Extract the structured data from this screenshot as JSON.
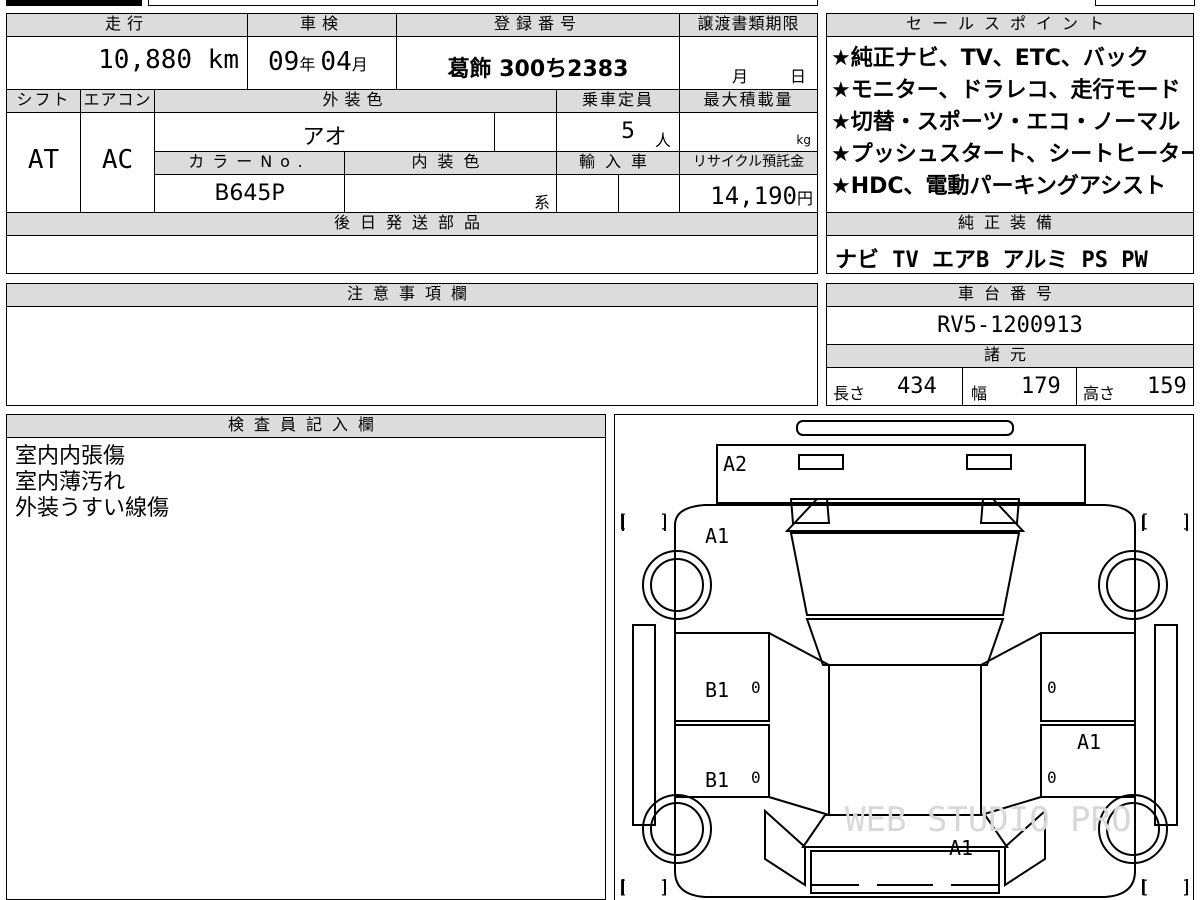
{
  "headers": {
    "mileage": "走行",
    "inspection": "車検",
    "registration": "登録番号",
    "transfer_deadline": "譲渡書類期限",
    "sales_point": "セールスポイント",
    "shift": "シフト",
    "aircon": "エアコン",
    "exterior_color": "外装色",
    "capacity": "乗車定員",
    "max_load": "最大積載量",
    "color_no": "カラーNo.",
    "interior_color": "内装色",
    "import": "輸入車",
    "recycle": "リサイクル預託金",
    "later_parts": "後日発送部品",
    "genuine_equipment": "純正装備",
    "notes": "注意事項欄",
    "chassis": "車台番号",
    "specs": "諸元",
    "inspector": "検査員記入欄"
  },
  "values": {
    "mileage": "10,880 km",
    "inspection_year": "09",
    "year_unit": "年",
    "inspection_month": "04",
    "month_unit": "月",
    "registration": "葛飾 300ち2383",
    "transfer_month": "月",
    "transfer_day": "日",
    "shift": "AT",
    "aircon": "AC",
    "exterior_color": "アオ",
    "capacity": "5",
    "capacity_unit": "人",
    "max_load_unit": "kg",
    "color_no": "B645P",
    "interior_suffix": "系",
    "recycle": "14,190",
    "recycle_unit": "円",
    "genuine_equipment": "ナビ TV エアB アルミ PS PW",
    "chassis": "RV5-1200913",
    "length_label": "長さ",
    "length": "434",
    "width_label": "幅",
    "width": "179",
    "height_label": "高さ",
    "height": "159"
  },
  "sales_points": [
    "★純正ナビ、TV、ETC、バック",
    "★モニター、ドラレコ、走行モード",
    "★切替・スポーツ・エコ・ノーマル",
    "★プッシュスタート、シートヒーター",
    "★HDC、電動パーキングアシスト"
  ],
  "inspector_remarks": [
    "室内内張傷",
    "室内薄汚れ",
    "外装うすい線傷"
  ],
  "diagram": {
    "marks": {
      "hood": "A2",
      "front_fender": "A1",
      "left_front_door": "B1",
      "left_rear_door": "B1",
      "right_rear_door": "A1",
      "trunk": "A1",
      "door_zero_1": "0",
      "door_zero_2": "0",
      "door_zero_3": "0",
      "door_zero_4": "0"
    },
    "watermark": "WEB STUDIO PRO"
  }
}
